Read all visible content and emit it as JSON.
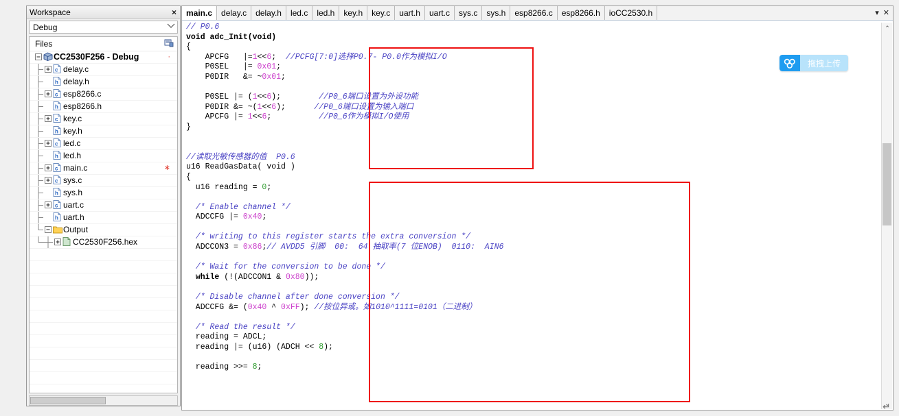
{
  "workspace": {
    "title": "Workspace",
    "close_label": "×",
    "config_selected": "Debug",
    "files_header": "Files",
    "files_header_icon": "workspace-overview-icon",
    "tree": [
      {
        "label": "CC2530F256 - Debug",
        "icon": "project-icon",
        "expander": "minus",
        "depth": 0,
        "root": true,
        "mark": "·"
      },
      {
        "label": "delay.c",
        "icon": "c-file-icon",
        "expander": "plus",
        "depth": 1
      },
      {
        "label": "delay.h",
        "icon": "h-file-icon",
        "expander": "none",
        "depth": 1
      },
      {
        "label": "esp8266.c",
        "icon": "c-file-icon",
        "expander": "plus",
        "depth": 1
      },
      {
        "label": "esp8266.h",
        "icon": "h-file-icon",
        "expander": "none",
        "depth": 1
      },
      {
        "label": "key.c",
        "icon": "c-file-icon",
        "expander": "plus",
        "depth": 1
      },
      {
        "label": "key.h",
        "icon": "h-file-icon",
        "expander": "none",
        "depth": 1
      },
      {
        "label": "led.c",
        "icon": "c-file-icon",
        "expander": "plus",
        "depth": 1
      },
      {
        "label": "led.h",
        "icon": "h-file-icon",
        "expander": "none",
        "depth": 1
      },
      {
        "label": "main.c",
        "icon": "c-file-icon",
        "expander": "plus",
        "depth": 1,
        "mark": "∗"
      },
      {
        "label": "sys.c",
        "icon": "c-file-icon",
        "expander": "plus",
        "depth": 1
      },
      {
        "label": "sys.h",
        "icon": "h-file-icon",
        "expander": "none",
        "depth": 1
      },
      {
        "label": "uart.c",
        "icon": "c-file-icon",
        "expander": "plus",
        "depth": 1
      },
      {
        "label": "uart.h",
        "icon": "h-file-icon",
        "expander": "none",
        "depth": 1
      },
      {
        "label": "Output",
        "icon": "folder-icon",
        "expander": "minus",
        "depth": 1
      },
      {
        "label": "CC2530F256.hex",
        "icon": "hex-file-icon",
        "expander": "plus",
        "depth": 2
      }
    ]
  },
  "editor": {
    "tabs": [
      {
        "label": "main.c",
        "active": true
      },
      {
        "label": "delay.c",
        "active": false
      },
      {
        "label": "delay.h",
        "active": false
      },
      {
        "label": "led.c",
        "active": false
      },
      {
        "label": "led.h",
        "active": false
      },
      {
        "label": "key.h",
        "active": false
      },
      {
        "label": "key.c",
        "active": false
      },
      {
        "label": "uart.h",
        "active": false
      },
      {
        "label": "uart.c",
        "active": false
      },
      {
        "label": "sys.c",
        "active": false
      },
      {
        "label": "sys.h",
        "active": false
      },
      {
        "label": "esp8266.c",
        "active": false
      },
      {
        "label": "esp8266.h",
        "active": false
      },
      {
        "label": "ioCC2530.h",
        "active": false
      }
    ],
    "tabbar_dropdown": "▾",
    "tabbar_close": "✕",
    "scroll_up": "⌃",
    "scroll_down": "⌄",
    "code_lines": [
      [
        {
          "t": "// P0.6",
          "c": "cmt"
        }
      ],
      [
        {
          "t": "void adc_Init(void)",
          "c": "kw"
        }
      ],
      [
        {
          "t": "{",
          "c": "pl"
        }
      ],
      [
        {
          "t": "    APCFG   |=",
          "c": "pl"
        },
        {
          "t": "1",
          "c": "num"
        },
        {
          "t": "<<",
          "c": "pl"
        },
        {
          "t": "6",
          "c": "num"
        },
        {
          "t": ";  ",
          "c": "pl"
        },
        {
          "t": "//PCFG[7:0]选择P0.7- P0.0作为模拟I/O",
          "c": "cmt"
        }
      ],
      [
        {
          "t": "    P0SEL   |= ",
          "c": "pl"
        },
        {
          "t": "0x01",
          "c": "num"
        },
        {
          "t": ";",
          "c": "pl"
        }
      ],
      [
        {
          "t": "    P0DIR   &= ~",
          "c": "pl"
        },
        {
          "t": "0x01",
          "c": "num"
        },
        {
          "t": ";",
          "c": "pl"
        }
      ],
      [
        {
          "t": "",
          "c": "pl"
        }
      ],
      [
        {
          "t": "    P0SEL |= (",
          "c": "pl"
        },
        {
          "t": "1",
          "c": "num"
        },
        {
          "t": "<<",
          "c": "pl"
        },
        {
          "t": "6",
          "c": "num"
        },
        {
          "t": ");        ",
          "c": "pl"
        },
        {
          "t": "//P0_6端口设置为外设功能",
          "c": "cmt"
        }
      ],
      [
        {
          "t": "    P0DIR &= ~(",
          "c": "pl"
        },
        {
          "t": "1",
          "c": "num"
        },
        {
          "t": "<<",
          "c": "pl"
        },
        {
          "t": "6",
          "c": "num"
        },
        {
          "t": ");      ",
          "c": "pl"
        },
        {
          "t": "//P0_6端口设置为输入端口",
          "c": "cmt"
        }
      ],
      [
        {
          "t": "    APCFG |= ",
          "c": "pl"
        },
        {
          "t": "1",
          "c": "num"
        },
        {
          "t": "<<",
          "c": "pl"
        },
        {
          "t": "6",
          "c": "num"
        },
        {
          "t": ";          ",
          "c": "pl"
        },
        {
          "t": "//P0_6作为模拟I/O使用",
          "c": "cmt"
        }
      ],
      [
        {
          "t": "}",
          "c": "pl"
        }
      ],
      [
        {
          "t": "",
          "c": "pl"
        }
      ],
      [
        {
          "t": "",
          "c": "pl"
        }
      ],
      [
        {
          "t": "//读取光敏传感器的值  P0.6",
          "c": "cmt"
        }
      ],
      [
        {
          "t": "u16 ReadGasData( void )",
          "c": "pl"
        }
      ],
      [
        {
          "t": "{",
          "c": "pl"
        }
      ],
      [
        {
          "t": "  u16 reading = ",
          "c": "pl"
        },
        {
          "t": "0",
          "c": "num0"
        },
        {
          "t": ";",
          "c": "pl"
        }
      ],
      [
        {
          "t": "",
          "c": "pl"
        }
      ],
      [
        {
          "t": "  ",
          "c": "pl"
        },
        {
          "t": "/* Enable channel */",
          "c": "cmt"
        }
      ],
      [
        {
          "t": "  ADCCFG |= ",
          "c": "pl"
        },
        {
          "t": "0x40",
          "c": "num"
        },
        {
          "t": ";",
          "c": "pl"
        }
      ],
      [
        {
          "t": "",
          "c": "pl"
        }
      ],
      [
        {
          "t": "  ",
          "c": "pl"
        },
        {
          "t": "/* writing to this register starts the extra conversion */",
          "c": "cmt"
        }
      ],
      [
        {
          "t": "  ADCCON3 = ",
          "c": "pl"
        },
        {
          "t": "0x86",
          "c": "num"
        },
        {
          "t": ";",
          "c": "pl"
        },
        {
          "t": "// AVDD5 引脚  00:  64 抽取率(7 位ENOB)  0110:  AIN6",
          "c": "cmt"
        }
      ],
      [
        {
          "t": "",
          "c": "pl"
        }
      ],
      [
        {
          "t": "  ",
          "c": "pl"
        },
        {
          "t": "/* Wait for the conversion to be done */",
          "c": "cmt"
        }
      ],
      [
        {
          "t": "  ",
          "c": "pl"
        },
        {
          "t": "while",
          "c": "kw"
        },
        {
          "t": " (!(ADCCON1 & ",
          "c": "pl"
        },
        {
          "t": "0x80",
          "c": "num"
        },
        {
          "t": "));",
          "c": "pl"
        }
      ],
      [
        {
          "t": "",
          "c": "pl"
        }
      ],
      [
        {
          "t": "  ",
          "c": "pl"
        },
        {
          "t": "/* Disable channel after done conversion */",
          "c": "cmt"
        }
      ],
      [
        {
          "t": "  ADCCFG &= (",
          "c": "pl"
        },
        {
          "t": "0x40",
          "c": "num"
        },
        {
          "t": " ^ ",
          "c": "pl"
        },
        {
          "t": "0xFF",
          "c": "num"
        },
        {
          "t": "); ",
          "c": "pl"
        },
        {
          "t": "//按位异或。如1010^1111=0101（二进制）",
          "c": "cmt"
        }
      ],
      [
        {
          "t": "",
          "c": "pl"
        }
      ],
      [
        {
          "t": "  ",
          "c": "pl"
        },
        {
          "t": "/* Read the result */",
          "c": "cmt"
        }
      ],
      [
        {
          "t": "  reading = ADCL;",
          "c": "pl"
        }
      ],
      [
        {
          "t": "  reading |= (u16) (ADCH << ",
          "c": "pl"
        },
        {
          "t": "8",
          "c": "num0"
        },
        {
          "t": ");",
          "c": "pl"
        }
      ],
      [
        {
          "t": "",
          "c": "pl"
        }
      ],
      [
        {
          "t": "  reading >>= ",
          "c": "pl"
        },
        {
          "t": "8",
          "c": "num0"
        },
        {
          "t": ";",
          "c": "pl"
        }
      ]
    ],
    "annotation_color": "#ee1111"
  },
  "upload_widget": {
    "label": "拖拽上传",
    "icon": "cloud-upload-icon",
    "accent": "#1f9cf0",
    "background": "#b8e3fb"
  },
  "misc": {
    "return_glyph": "↵"
  }
}
